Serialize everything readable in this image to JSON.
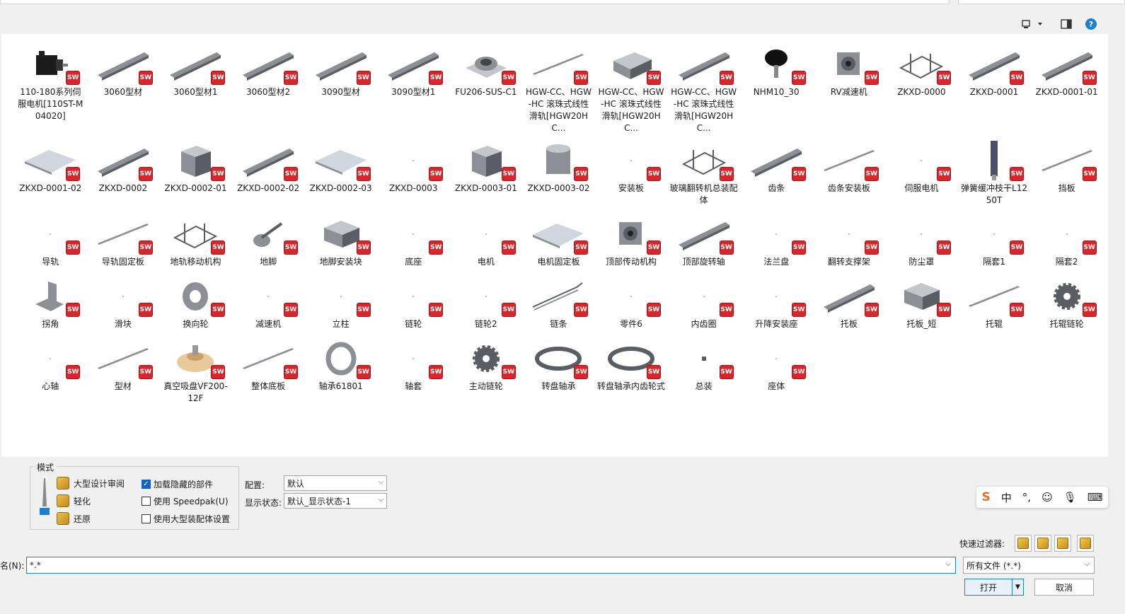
{
  "toolbar": {
    "view_icon": "view-menu-icon",
    "pane_icon": "preview-pane-icon",
    "help_label": "?"
  },
  "files": [
    {
      "label": "110-180系列伺服电机[110ST-M04020]",
      "kind": "motor"
    },
    {
      "label": "3060型材",
      "kind": "rail"
    },
    {
      "label": "3060型材1",
      "kind": "rail"
    },
    {
      "label": "3060型材2",
      "kind": "rail"
    },
    {
      "label": "3090型材",
      "kind": "rail"
    },
    {
      "label": "3090型材1",
      "kind": "rail"
    },
    {
      "label": "FU206-SUS-C1",
      "kind": "bearing-block"
    },
    {
      "label": "HGW-CC、HGW-HC 滚珠式线性滑轨[HGW20HC...",
      "kind": "thin-rail"
    },
    {
      "label": "HGW-CC、HGW-HC 滚珠式线性滑轨[HGW20HC...",
      "kind": "slider"
    },
    {
      "label": "HGW-CC、HGW-HC 滚珠式线性滑轨[HGW20HC...",
      "kind": "rail"
    },
    {
      "label": "NHM10_30",
      "kind": "knob"
    },
    {
      "label": "RV减速机",
      "kind": "gearbox"
    },
    {
      "label": "ZKXD-0000",
      "kind": "frame"
    },
    {
      "label": "ZKXD-0001",
      "kind": "rail"
    },
    {
      "label": "ZKXD-0001-01",
      "kind": "rail"
    },
    {
      "label": "ZKXD-0001-02",
      "kind": "plate"
    },
    {
      "label": "ZKXD-0002",
      "kind": "rail"
    },
    {
      "label": "ZKXD-0002-01",
      "kind": "box"
    },
    {
      "label": "ZKXD-0002-02",
      "kind": "rail"
    },
    {
      "label": "ZKXD-0002-03",
      "kind": "plate"
    },
    {
      "label": "ZKXD-0003",
      "kind": "blank"
    },
    {
      "label": "ZKXD-0003-01",
      "kind": "box"
    },
    {
      "label": "ZKXD-0003-02",
      "kind": "cylinder"
    },
    {
      "label": "安装板",
      "kind": "blank"
    },
    {
      "label": "玻璃翻转机总装配体",
      "kind": "frame"
    },
    {
      "label": "齿条",
      "kind": "rail"
    },
    {
      "label": "齿条安装板",
      "kind": "thin-rail"
    },
    {
      "label": "伺服电机",
      "kind": "blank"
    },
    {
      "label": "弹簧缓冲枝干L1250T",
      "kind": "spring"
    },
    {
      "label": "挡板",
      "kind": "thin-rail"
    },
    {
      "label": "导轨",
      "kind": "blank"
    },
    {
      "label": "导轨固定板",
      "kind": "thin-rail"
    },
    {
      "label": "地轨移动机构",
      "kind": "frame"
    },
    {
      "label": "地脚",
      "kind": "foot"
    },
    {
      "label": "地脚安装块",
      "kind": "block"
    },
    {
      "label": "底座",
      "kind": "blank"
    },
    {
      "label": "电机",
      "kind": "blank"
    },
    {
      "label": "电机固定板",
      "kind": "plate"
    },
    {
      "label": "顶部传动机构",
      "kind": "gearbox"
    },
    {
      "label": "顶部旋转轴",
      "kind": "rail"
    },
    {
      "label": "法兰盘",
      "kind": "blank"
    },
    {
      "label": "翻转支撑架",
      "kind": "blank"
    },
    {
      "label": "防尘罩",
      "kind": "blank"
    },
    {
      "label": "隔套1",
      "kind": "blank"
    },
    {
      "label": "隔套2",
      "kind": "blank"
    },
    {
      "label": "拐角",
      "kind": "bracket"
    },
    {
      "label": "滑块",
      "kind": "blank"
    },
    {
      "label": "换向轮",
      "kind": "wheel"
    },
    {
      "label": "减速机",
      "kind": "blank"
    },
    {
      "label": "立柱",
      "kind": "blank"
    },
    {
      "label": "链轮",
      "kind": "blank"
    },
    {
      "label": "链轮2",
      "kind": "blank"
    },
    {
      "label": "链条",
      "kind": "chain"
    },
    {
      "label": "零件6",
      "kind": "blank"
    },
    {
      "label": "内齿圈",
      "kind": "blank"
    },
    {
      "label": "升降安装座",
      "kind": "blank"
    },
    {
      "label": "托板",
      "kind": "rail"
    },
    {
      "label": "托板_短",
      "kind": "block"
    },
    {
      "label": "托辊",
      "kind": "thin-rail"
    },
    {
      "label": "托辊链轮",
      "kind": "gear"
    },
    {
      "label": "心轴",
      "kind": "blank"
    },
    {
      "label": "型材",
      "kind": "thin-rail"
    },
    {
      "label": "真空吸盘VF200-12F",
      "kind": "cup"
    },
    {
      "label": "整体底板",
      "kind": "thin-rail"
    },
    {
      "label": "轴承61801",
      "kind": "ring"
    },
    {
      "label": "轴套",
      "kind": "blank"
    },
    {
      "label": "主动链轮",
      "kind": "gear"
    },
    {
      "label": "转盘轴承",
      "kind": "slewing"
    },
    {
      "label": "转盘轴承内齿轮式",
      "kind": "slewing"
    },
    {
      "label": "总装",
      "kind": "small"
    },
    {
      "label": "座体",
      "kind": "blank"
    }
  ],
  "sw_badge": "SW",
  "mode": {
    "legend": "模式",
    "items": [
      "大型设计审阅",
      "轻化",
      "还原"
    ]
  },
  "options": {
    "load_hidden": "加载隐藏的部件",
    "load_hidden_checked": true,
    "use_speedpak": "使用 Speedpak(U)",
    "use_speedpak_checked": false,
    "use_large_asm": "使用大型装配体设置",
    "use_large_asm_checked": false
  },
  "config": {
    "config_label": "配置:",
    "config_value": "默认",
    "display_label": "显示状态:",
    "display_value": "默认_显示状态-1"
  },
  "ime": {
    "logo": "S",
    "lang": "中",
    "punct": "°,",
    "emoji": "☺",
    "mic": "🎙",
    "kbd": "⌨"
  },
  "quick_filter": {
    "label": "快速过滤器:"
  },
  "filename": {
    "label": "名(N):",
    "value": "*.*"
  },
  "filetype": {
    "value": "所有文件 (*.*)"
  },
  "buttons": {
    "open": "打开",
    "cancel": "取消"
  }
}
